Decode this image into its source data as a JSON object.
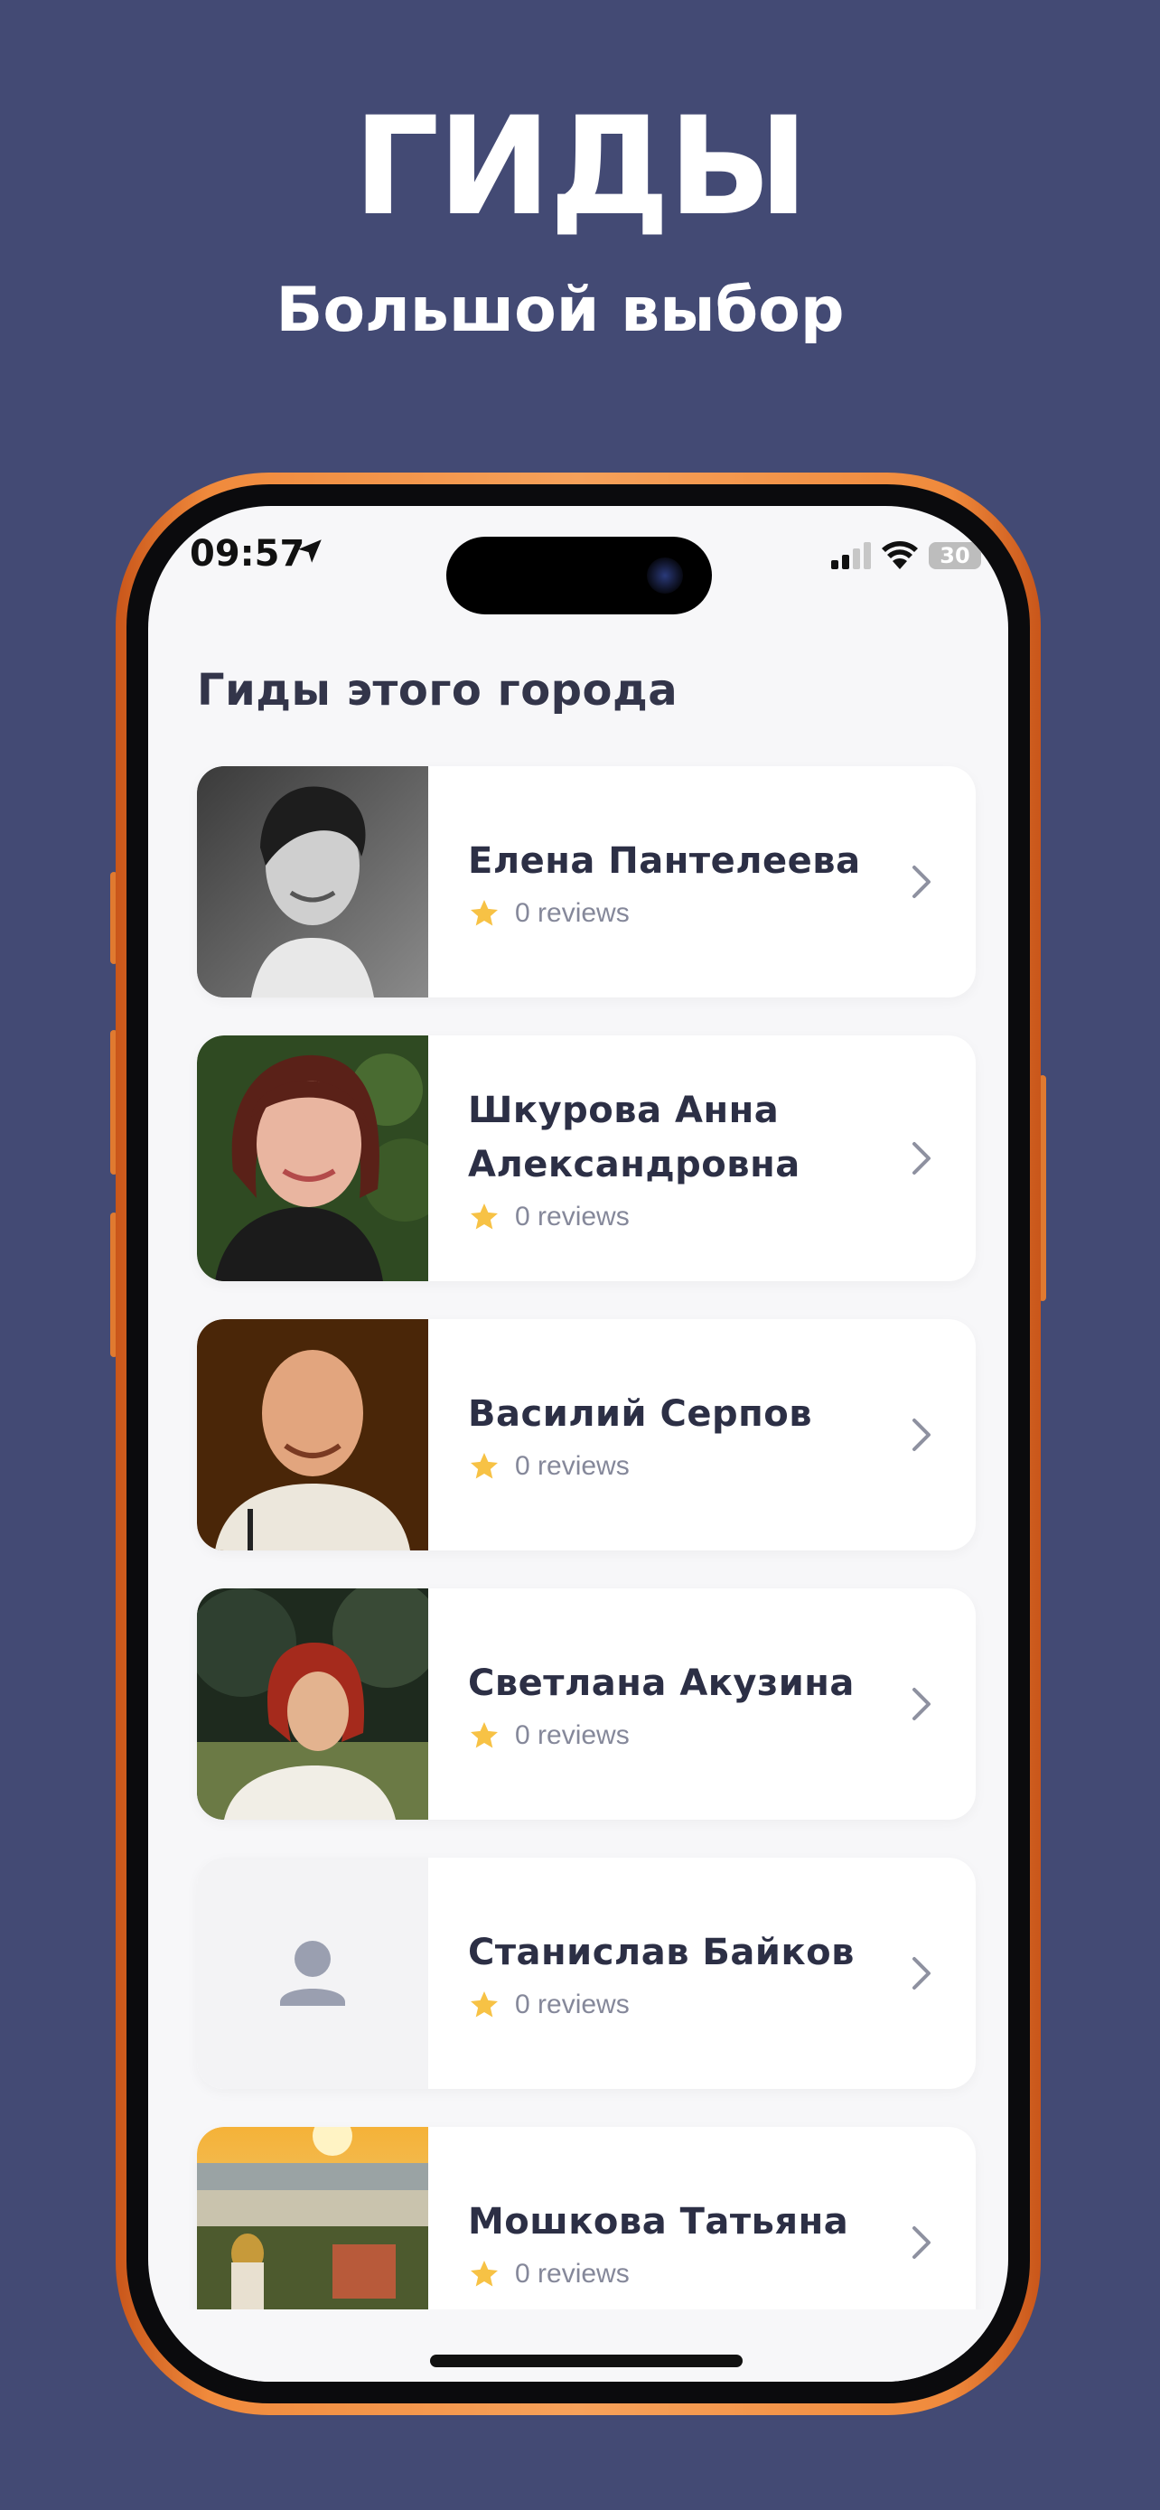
{
  "promo": {
    "headline": "ГИДЫ",
    "subheadline": "Большой выбор"
  },
  "status_bar": {
    "time": "09:57",
    "battery": "30"
  },
  "screen": {
    "title": "Гиды этого города"
  },
  "guides": [
    {
      "name": "Елена Пантелеева",
      "reviews": "0 reviews",
      "photo": "portrait-bw-woman"
    },
    {
      "name": "Шкурова Анна Александровна",
      "reviews": "0 reviews",
      "photo": "portrait-woman-red-hair"
    },
    {
      "name": "Василий Серпов",
      "reviews": "0 reviews",
      "photo": "portrait-man-bald"
    },
    {
      "name": "Светлана Акузина",
      "reviews": "0 reviews",
      "photo": "portrait-woman-outdoors"
    },
    {
      "name": "Станислав Байков",
      "reviews": "0 reviews",
      "photo": "placeholder-person-icon"
    },
    {
      "name": "Мошкова Татьяна",
      "reviews": "0 reviews",
      "photo": "city-sunset"
    }
  ],
  "colors": {
    "background": "#434a74",
    "phone_frame": "#f08a3c",
    "star": "#f7c245",
    "chevron": "#8e91a0"
  }
}
